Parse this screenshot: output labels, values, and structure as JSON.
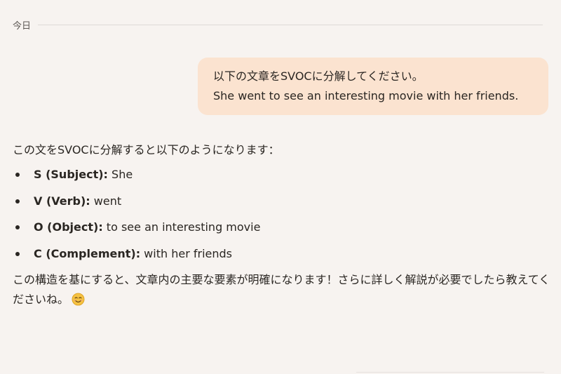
{
  "date_divider": {
    "label": "今日"
  },
  "user_message": {
    "line1": "以下の文章をSVOCに分解してください。",
    "line2": "She went to see an interesting movie with her friends."
  },
  "assistant_message": {
    "intro": "この文をSVOCに分解すると以下のようになります：",
    "items": [
      {
        "term": "S (Subject):",
        "value": " She"
      },
      {
        "term": "V (Verb):",
        "value": " went"
      },
      {
        "term": "O (Object):",
        "value": " to see an interesting movie"
      },
      {
        "term": "C (Complement):",
        "value": " with her friends"
      }
    ],
    "closing": "この構造を基にすると、文章内の主要な要素が明確になります！さらに詳しく解説が必要でしたら教えてくださいね。",
    "emoji_icon": "smiling-face-icon"
  },
  "colors": {
    "background": "#f7f3f0",
    "user_bubble": "#fbe3d0",
    "text": "#2a2622",
    "emoji_face": "#f5c242"
  }
}
